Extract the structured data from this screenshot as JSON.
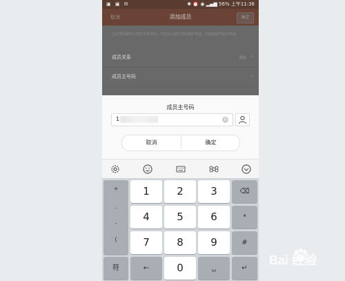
{
  "statusbar": {
    "left_icons": "▣ ▣ ✉",
    "right": "✱ ⏰ ◉ ▂▄▆ 56% 上午11:36"
  },
  "appbar": {
    "cancel": "取消",
    "title": "添加成员",
    "confirm": "确定"
  },
  "background": {
    "hint": "主副号码都可以拨打本机号码，不在可以被主号码拨打电话，不能拨副号码打电话。",
    "rows": [
      {
        "label": "成员关系",
        "value": "朋友"
      },
      {
        "label": "成员主号码",
        "value": ""
      }
    ]
  },
  "dialog": {
    "title": "成员主号码",
    "input_value": "1",
    "cancel": "取消",
    "confirm": "确定"
  },
  "keyboard": {
    "symbols": [
      "+",
      ".",
      "-",
      "("
    ],
    "digits": [
      "1",
      "2",
      "3",
      "4",
      "5",
      "6",
      "7",
      "8",
      "9",
      "0"
    ],
    "right_keys": [
      "⌫",
      "*",
      "#",
      "↵"
    ],
    "switch_label": "符",
    "back_label": "←",
    "space_label": "␣"
  },
  "icons": {
    "toolbar": [
      "settings-icon",
      "emoji-icon",
      "keyboard-icon",
      "command-icon",
      "collapse-icon"
    ],
    "contact": "person-icon"
  },
  "watermark": {
    "text": "Bai 经验"
  },
  "colors": {
    "appbar": "#6b4236",
    "dim": "#696969",
    "keyboard": "#d2d5d9"
  }
}
